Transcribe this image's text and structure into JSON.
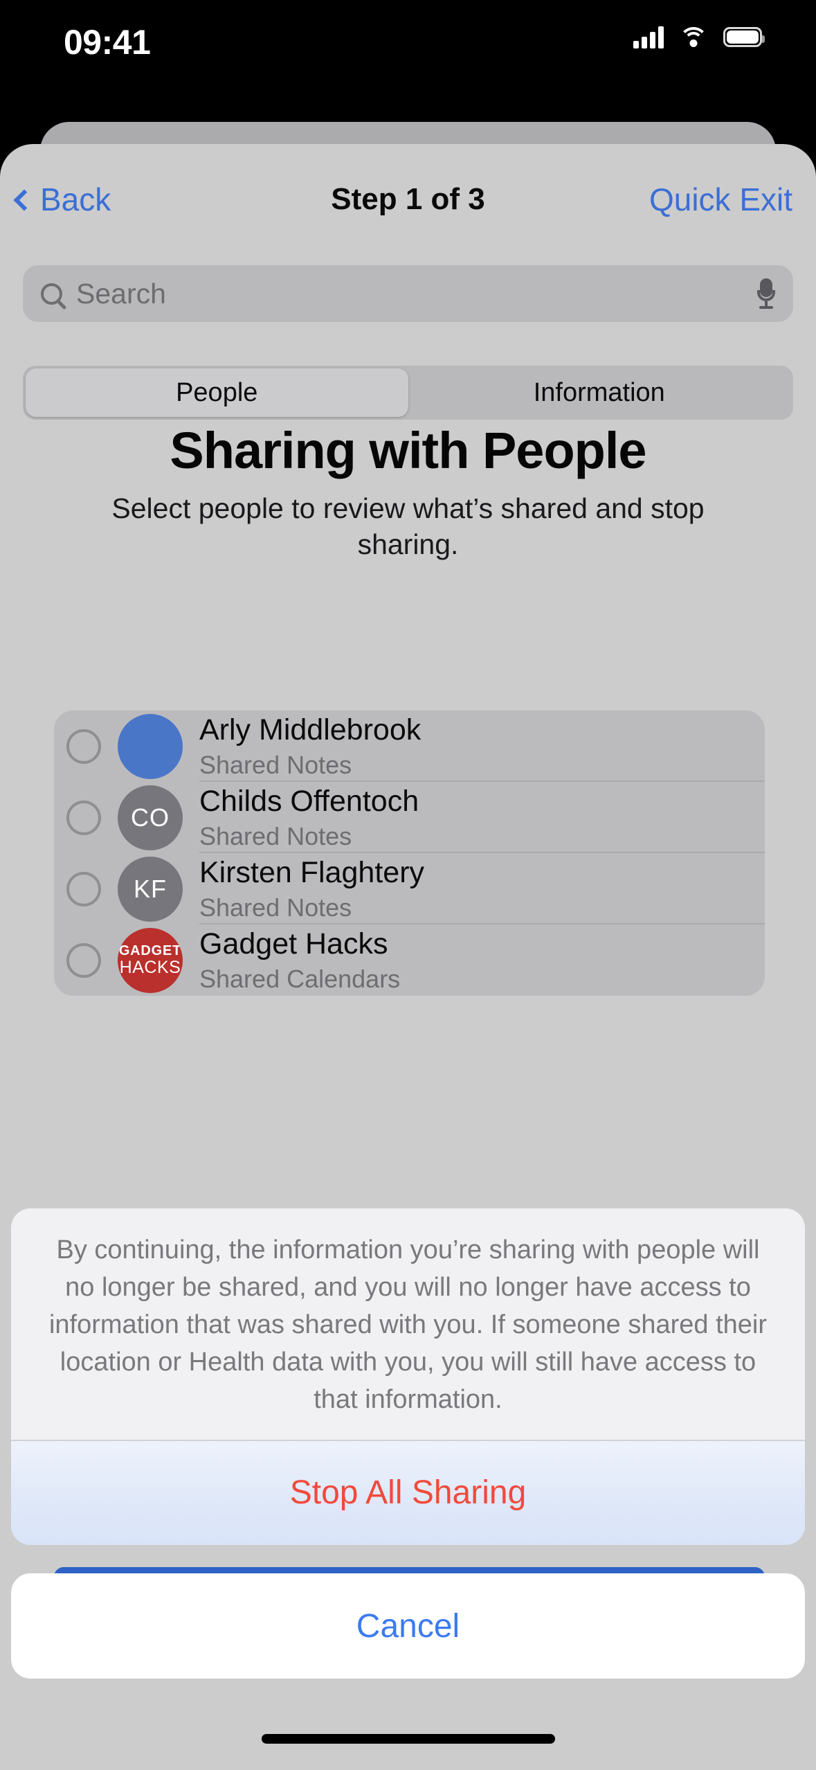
{
  "status_bar": {
    "time": "09:41",
    "cellular_icon": "cellular-bars-icon",
    "wifi_icon": "wifi-icon",
    "battery_icon": "battery-full-icon"
  },
  "nav": {
    "back_label": "Back",
    "back_icon": "chevron-left-icon",
    "title": "Step 1 of 3",
    "quick_exit_label": "Quick Exit"
  },
  "search": {
    "placeholder": "Search",
    "value": "",
    "search_icon": "search-icon",
    "mic_icon": "microphone-icon"
  },
  "segmented": {
    "options": [
      {
        "label": "People",
        "selected": true
      },
      {
        "label": "Information",
        "selected": false
      }
    ]
  },
  "headline": "Sharing with People",
  "subheadline": "Select people to review what’s shared and stop sharing.",
  "people": [
    {
      "name": "Arly Middlebrook",
      "detail": "Shared Notes",
      "avatar_kind": "solid",
      "avatar_initials": "",
      "avatar_color": "#4a76c8",
      "selected": false
    },
    {
      "name": "Childs Offentoch",
      "detail": "Shared Notes",
      "avatar_kind": "initials",
      "avatar_initials": "CO",
      "avatar_color": "#76767c",
      "selected": false
    },
    {
      "name": "Kirsten Flaghtery",
      "detail": "Shared Notes",
      "avatar_kind": "initials",
      "avatar_initials": "KF",
      "avatar_color": "#76767c",
      "selected": false
    },
    {
      "name": "Gadget Hacks",
      "detail": "Shared Calendars",
      "avatar_kind": "logo",
      "avatar_initials": "",
      "avatar_logo_line1": "GADGET",
      "avatar_logo_line2": "HACKS",
      "avatar_color": "#b9302c",
      "selected": false
    }
  ],
  "action_sheet": {
    "disclaimer": "By continuing, the information you’re sharing with people will no longer be shared, and you will no longer have access to information that was shared with you. If someone shared their location or Health data with you, you will still have access to that information.",
    "stop_all_label": "Stop All Sharing",
    "stop_all_color": "#f04a3c"
  },
  "cancel": {
    "label": "Cancel",
    "color": "#3b7bf0"
  },
  "colors": {
    "accent_blue": "#3b6fd4",
    "sheet_background": "#cccccd",
    "list_background": "#bbbbbd",
    "strip_blue": "#2e62c4"
  }
}
